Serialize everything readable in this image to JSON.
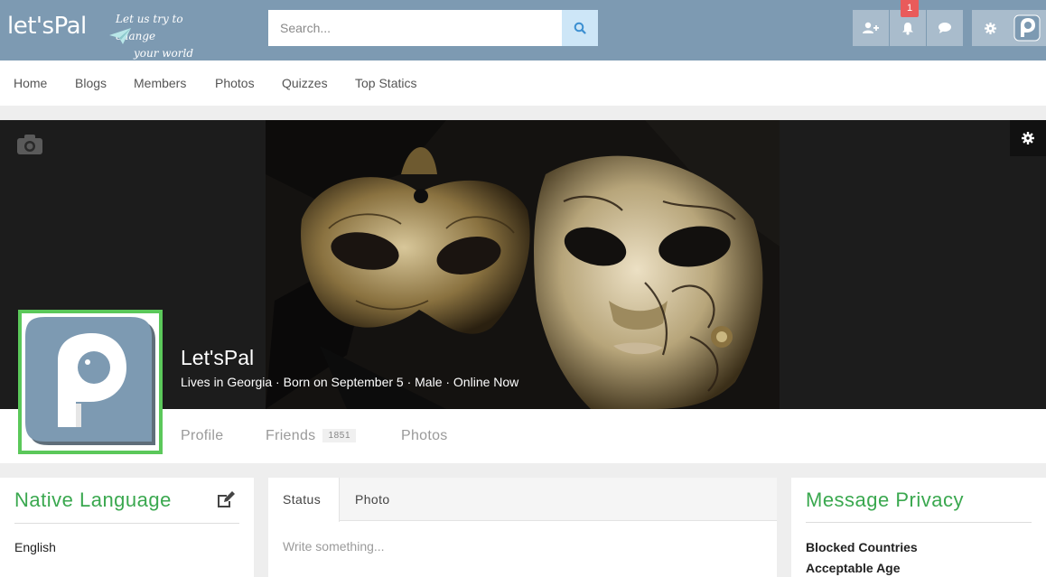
{
  "header": {
    "logo_text": "let'sPal",
    "tagline_line1": "Let us try to change",
    "tagline_line2": "your world",
    "search_placeholder": "Search...",
    "notification_count": "1",
    "brand_color": "#7d9ab2",
    "icons": [
      "search-icon",
      "add-friend-icon",
      "bell-icon",
      "chat-icon",
      "gear-icon",
      "user-avatar"
    ]
  },
  "nav": {
    "items": [
      "Home",
      "Blogs",
      "Members",
      "Photos",
      "Quizzes",
      "Top Statics"
    ]
  },
  "profile": {
    "name": "Let'sPal",
    "info": "Lives in Georgia · Born on September 5 · Male · Online Now",
    "avatar_border_color": "#5bc85a"
  },
  "profile_tabs": {
    "profile": "Profile",
    "friends": "Friends",
    "friends_count": "1851",
    "photos": "Photos"
  },
  "left_panel": {
    "title": "Native Language",
    "value": "English"
  },
  "status_panel": {
    "tab_status": "Status",
    "tab_photo": "Photo",
    "placeholder": "Write something..."
  },
  "right_panel": {
    "title": "Message Privacy",
    "label1": "Blocked Countries",
    "label2": "Acceptable Age"
  },
  "accent_color": "#3aa84f"
}
